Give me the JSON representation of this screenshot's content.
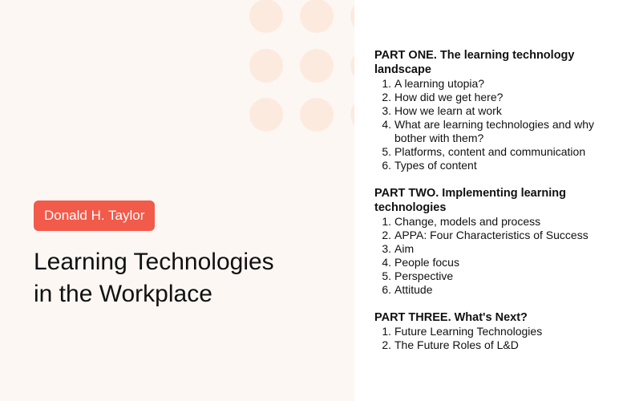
{
  "cover": {
    "author": "Donald H. Taylor",
    "title_line1": "Learning Technologies",
    "title_line2": "in the Workplace"
  },
  "colors": {
    "panel_background": "#fcf7f3",
    "dot": "#fdeade",
    "badge": "#f25a4a",
    "text": "#111111"
  },
  "toc": {
    "parts": [
      {
        "title": "PART ONE. The learning technology landscape",
        "items": [
          {
            "num": "1.",
            "label": "A learning utopia?"
          },
          {
            "num": "2.",
            "label": "How did we get here?"
          },
          {
            "num": "3.",
            "label": "How we learn at work"
          },
          {
            "num": "4.",
            "label": "What are learning technologies and why bother with them?"
          },
          {
            "num": "5.",
            "label": "Platforms, content and communication"
          },
          {
            "num": "6.",
            "label": "Types of content"
          }
        ]
      },
      {
        "title": "PART TWO. Implementing learning technologies",
        "items": [
          {
            "num": "1.",
            "label": "Change, models and process"
          },
          {
            "num": "2.",
            "label": "APPA: Four Characteristics of Success"
          },
          {
            "num": "3.",
            "label": "Aim"
          },
          {
            "num": "4.",
            "label": "People focus"
          },
          {
            "num": "5.",
            "label": "Perspective"
          },
          {
            "num": "6.",
            "label": "Attitude"
          }
        ]
      },
      {
        "title": "PART THREE. What's Next?",
        "items": [
          {
            "num": "1.",
            "label": "Future Learning Technologies"
          },
          {
            "num": "2.",
            "label": "The Future Roles of L&D"
          }
        ]
      }
    ]
  }
}
